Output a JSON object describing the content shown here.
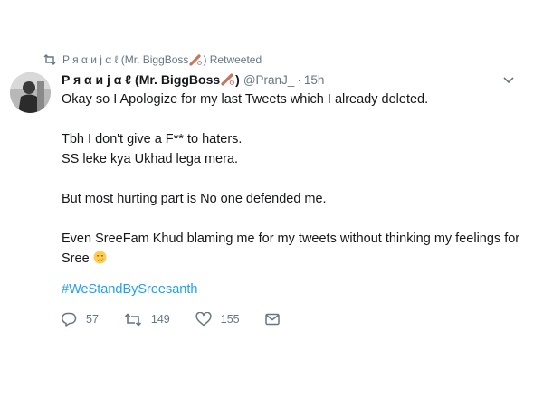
{
  "retweet_bar": {
    "text": "P я α и j α ℓ (Mr. BiggBoss",
    "suffix": ") Retweeted",
    "icon": "retweet-icon"
  },
  "author": {
    "display_name": "P я α и j α ℓ (Mr. BiggBoss",
    "display_name_suffix": ")",
    "handle": "@PranJ_",
    "separator": "·",
    "time": "15h"
  },
  "tweet": {
    "lines": [
      "Okay so I Apologize for my last Tweets which I already deleted.",
      "Tbh I don't give a F** to haters.",
      "SS leke kya Ukhad lega mera.",
      "But most hurting part is No one defended me.",
      "Even SreeFam Khud blaming me for my tweets without thinking my feelings for",
      "Sree"
    ],
    "hashtag": "#WeStandBySreesanth"
  },
  "actions": {
    "replies": "57",
    "retweets": "149",
    "likes": "155",
    "icons": [
      "reply-icon",
      "retweet-icon",
      "heart-icon",
      "mail-icon"
    ]
  },
  "colors": {
    "link": "#1da1f2",
    "muted": "#657786",
    "text": "#14171a"
  }
}
